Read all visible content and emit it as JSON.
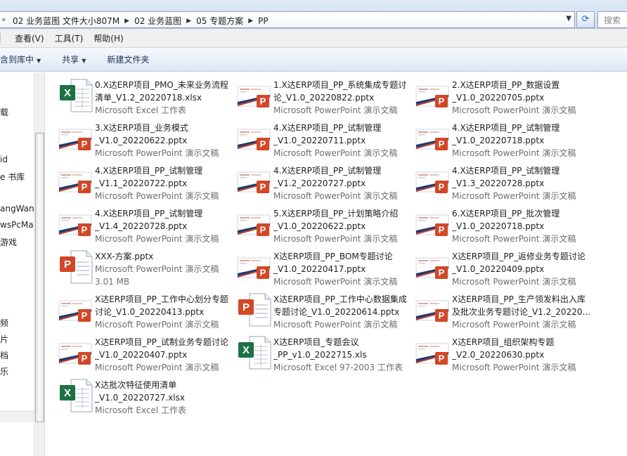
{
  "address_bar": {
    "back_glyph": "«",
    "crumbs": [
      "02 业务蓝图 文件大小807M",
      "02 业务蓝图",
      "05 专题方案",
      "PP"
    ],
    "search_placeholder": "搜索"
  },
  "menu": {
    "view": "查看(V)",
    "tools": "工具(T)",
    "help": "帮助(H)"
  },
  "toolbar": {
    "include_library": "含到库中",
    "share": "共享",
    "new_folder": "新建文件夹"
  },
  "nav_pane": {
    "items": [
      "载",
      "id",
      "e 书库",
      "angWang",
      "wsPcMa",
      "游戏",
      "频",
      "片",
      "档",
      "乐"
    ]
  },
  "files": [
    {
      "name": "0.X达ERP项目_PMO_未来业务流程\n清单_V1.2_20220718.xlsx",
      "type": "Microsoft Excel 工作表",
      "size": "",
      "icon": "excel-icon"
    },
    {
      "name": "1.X达ERP项目_PP_系统集成专题讨\n论_V1.0_20220822.pptx",
      "type": "Microsoft PowerPoint 演示文稿",
      "size": "",
      "icon": "ppt-thumb-icon"
    },
    {
      "name": "2.X达ERP项目_PP_数据设置\n_V1.0_20220705.pptx",
      "type": "Microsoft PowerPoint 演示文稿",
      "size": "",
      "icon": "ppt-thumb-icon"
    },
    {
      "name": "3.X达ERP项目_业务模式\n_V1.0_20220622.pptx",
      "type": "Microsoft PowerPoint 演示文稿",
      "size": "",
      "icon": "ppt-thumb-icon"
    },
    {
      "name": "4.X达ERP项目_PP_试制管理\n_V1.0_20220711.pptx",
      "type": "Microsoft PowerPoint 演示文稿",
      "size": "",
      "icon": "ppt-thumb-icon"
    },
    {
      "name": "4.X达ERP项目_PP_试制管理\n_V1.0_20220718.pptx",
      "type": "Microsoft PowerPoint 演示文稿",
      "size": "",
      "icon": "ppt-thumb-icon"
    },
    {
      "name": "4.X达ERP项目_PP_试制管理\n_V1.1_20220722.pptx",
      "type": "Microsoft PowerPoint 演示文稿",
      "size": "",
      "icon": "ppt-thumb-icon"
    },
    {
      "name": "4.X达ERP项目_PP_试制管理\n_V1.2_20220727.pptx",
      "type": "Microsoft PowerPoint 演示文稿",
      "size": "",
      "icon": "ppt-thumb-icon"
    },
    {
      "name": "4.X达ERP项目_PP_试制管理\n_V1.3_20220728.pptx",
      "type": "Microsoft PowerPoint 演示文稿",
      "size": "",
      "icon": "ppt-thumb-icon"
    },
    {
      "name": "4.X达ERP项目_PP_试制管理\n_V1.4_20220728.pptx",
      "type": "Microsoft PowerPoint 演示文稿",
      "size": "",
      "icon": "ppt-thumb-icon"
    },
    {
      "name": "5.X达ERP项目_PP_计划策略介绍\n_V1.0_20220622.pptx",
      "type": "Microsoft PowerPoint 演示文稿",
      "size": "",
      "icon": "ppt-thumb-icon"
    },
    {
      "name": "6.X达ERP项目_PP_批次管理\n_V1.0_20220718.pptx",
      "type": "Microsoft PowerPoint 演示文稿",
      "size": "",
      "icon": "ppt-thumb-icon"
    },
    {
      "name": "XXX-方案.pptx",
      "type": "Microsoft PowerPoint 演示文稿",
      "size": "3.01 MB",
      "icon": "ppt-doc-icon"
    },
    {
      "name": "X达ERP项目_PP_BOM专题讨论\n_V1.0_20220417.pptx",
      "type": "Microsoft PowerPoint 演示文稿",
      "size": "",
      "icon": "ppt-thumb-icon"
    },
    {
      "name": "X达ERP项目_PP_返修业务专题讨论\n_V1.0_20220409.pptx",
      "type": "Microsoft PowerPoint 演示文稿",
      "size": "",
      "icon": "ppt-thumb-icon"
    },
    {
      "name": "X达ERP项目_PP_工作中心划分专题\n讨论_V1.0_20220413.pptx",
      "type": "Microsoft PowerPoint 演示文稿",
      "size": "",
      "icon": "ppt-thumb-icon"
    },
    {
      "name": "X达ERP项目_PP_工作中心数据集成\n专题讨论_V1.0_20220614.pptx",
      "type": "Microsoft PowerPoint 演示文稿",
      "size": "",
      "icon": "ppt-doc-icon"
    },
    {
      "name": "X达ERP项目_PP_生产领发料出入库\n及批次业务专题讨论_V1.2_20220...",
      "type": "Microsoft PowerPoint 演示文稿",
      "size": "",
      "icon": "ppt-thumb-icon"
    },
    {
      "name": "X达ERP项目_PP_试制业务专题讨论\n_V1.0_20220407.pptx",
      "type": "Microsoft PowerPoint 演示文稿",
      "size": "",
      "icon": "ppt-thumb-icon"
    },
    {
      "name": "X达ERP项目_专题会议\n_PP_v1.0_2022715.xls",
      "type": "Microsoft Excel 97-2003 工作表",
      "size": "",
      "icon": "excel-icon"
    },
    {
      "name": "X达ERP项目_组织架构专题\n_V2.0_20220630.pptx",
      "type": "Microsoft PowerPoint 演示文稿",
      "size": "",
      "icon": "ppt-thumb-icon"
    },
    {
      "name": "X达批次特征使用清单\n_V1.0_20220727.xlsx",
      "type": "Microsoft Excel 工作表",
      "size": "",
      "icon": "excel-icon"
    }
  ],
  "colors": {
    "ppt_orange": "#d24726",
    "excel_green": "#1e7145",
    "slide_red": "#c0392b",
    "slide_navy": "#1f3a6e"
  }
}
